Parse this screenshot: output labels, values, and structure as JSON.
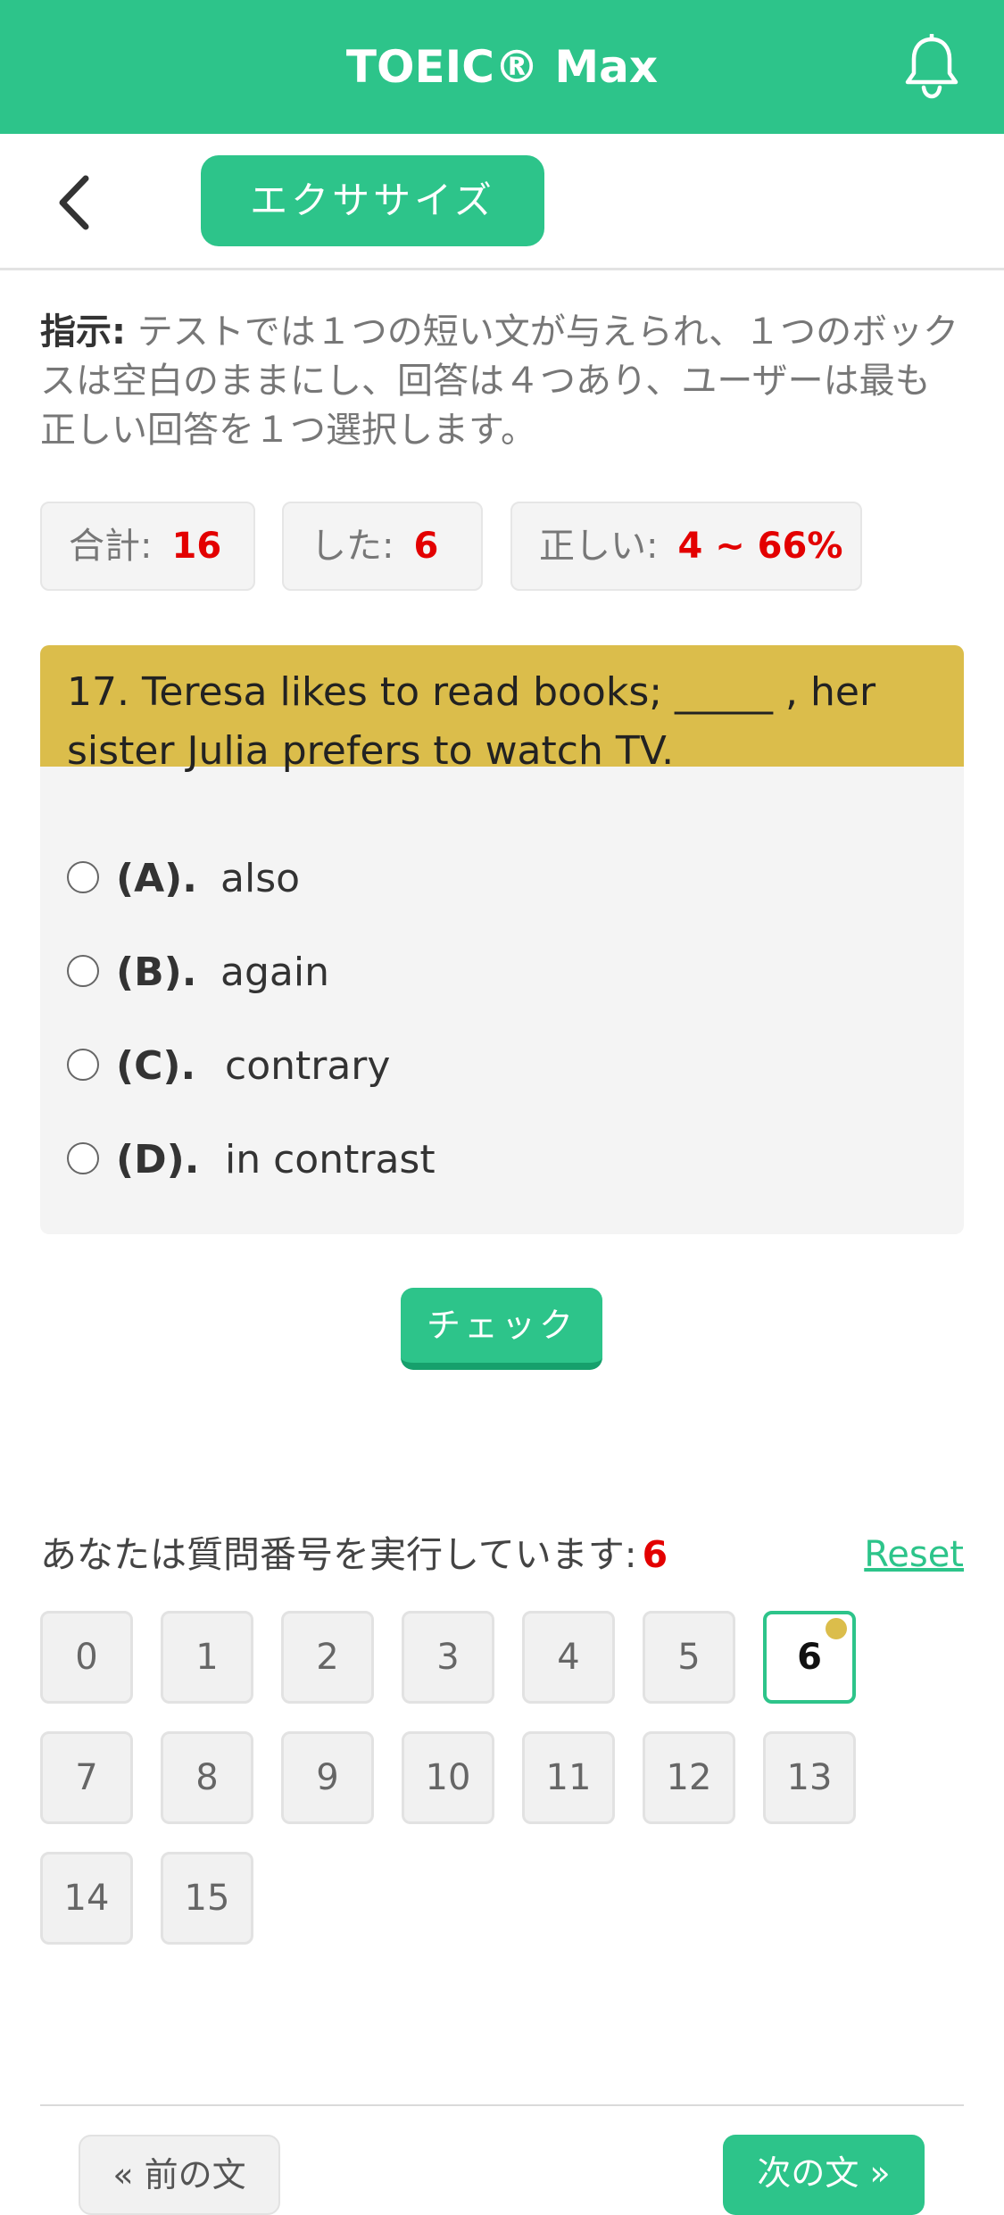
{
  "app": {
    "title": "TOEIC® Max"
  },
  "nav": {
    "tab_label": "エクササイズ"
  },
  "instructions": {
    "label": "指示:",
    "text": "テストでは１つの短い文が与えられ、１つのボックスは空白のままにし、回答は４つあり、ユーザーは最も正しい回答を１つ選択します。"
  },
  "stats": [
    {
      "label": "合計:",
      "value": "16"
    },
    {
      "label": "した:",
      "value": "6"
    },
    {
      "label": "正しい:",
      "value": "4 ~ 66%"
    }
  ],
  "question": {
    "text": "17. Teresa likes to read books; _____ , her sister Julia prefers to watch TV.",
    "options": [
      {
        "letter": "(A).",
        "text": "also"
      },
      {
        "letter": "(B).",
        "text": "again"
      },
      {
        "letter": "(C).",
        "text": "contrary"
      },
      {
        "letter": "(D).",
        "text": "in contrast"
      }
    ]
  },
  "check_label": "チェック",
  "progress": {
    "label": "あなたは質問番号を実行しています:",
    "current": "6",
    "reset_label": "Reset",
    "numbers": [
      "0",
      "1",
      "2",
      "3",
      "4",
      "5",
      "6",
      "7",
      "8",
      "9",
      "10",
      "11",
      "12",
      "13",
      "14",
      "15"
    ]
  },
  "footer": {
    "prev_label": "« 前の文",
    "next_label": "次の文 »"
  },
  "colors": {
    "primary": "#2dc48a",
    "question_header": "#dbbd4b",
    "accent_red": "#e30000"
  }
}
